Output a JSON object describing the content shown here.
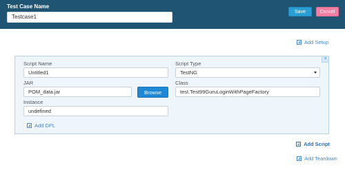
{
  "header": {
    "test_case_label": "Test Case Name",
    "test_case_value": "Testcase1",
    "save_label": "Save",
    "cancel_label": "Cancel"
  },
  "links": {
    "add_setup": "Add Setup",
    "add_script": "Add Script",
    "add_teardown": "Add Teardown",
    "add_dpl": "Add DPL"
  },
  "script": {
    "name_label": "Script Name",
    "name_value": "Untitled1",
    "type_label": "Script Type",
    "type_value": "TestNG",
    "jar_label": "JAR",
    "jar_value": "POM_data.jar",
    "browse_label": "Browse",
    "class_label": "Class",
    "class_value": "test.Test99GuruLoginWithPageFactory",
    "instance_label": "Instance",
    "instance_value": "undefined",
    "close_glyph": "×"
  },
  "colors": {
    "header_bg": "#1f5572",
    "save": "#2a9fd6",
    "cancel": "#f07fa3",
    "browse": "#1f88d6",
    "link": "#4a87c6",
    "panel_bg": "#eef5fb"
  },
  "icons": {
    "add": "plus-square-icon",
    "close": "close-icon",
    "dropdown": "chevron-down-icon"
  }
}
